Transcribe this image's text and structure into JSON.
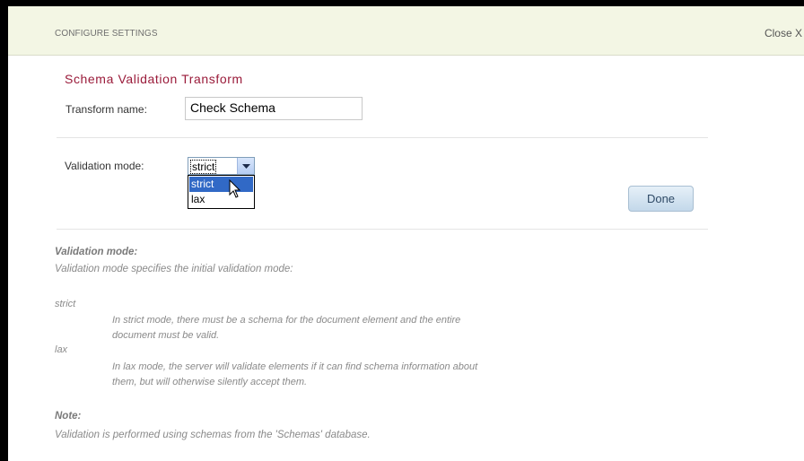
{
  "dialog": {
    "header_title": "CONFIGURE SETTINGS",
    "close_label": "Close X"
  },
  "form": {
    "section_title": "Schema Validation Transform",
    "transform_name_label": "Transform name:",
    "transform_name_value": "Check Schema",
    "validation_mode_label": "Validation mode:",
    "validation_mode_selected": "strict",
    "validation_mode_options": [
      "strict",
      "lax"
    ],
    "done_label": "Done"
  },
  "help": {
    "heading": "Validation mode:",
    "intro": "Validation mode specifies the initial validation mode:",
    "terms": [
      {
        "term": "strict",
        "line1": "In strict mode, there must be a schema for the document element and the entire",
        "line2": "document must be valid."
      },
      {
        "term": "lax",
        "line1": "In lax mode, the server will validate elements if it can find schema information about",
        "line2": "them, but will otherwise silently accept them."
      }
    ],
    "note_heading": "Note:",
    "note_text": "Validation is performed using schemas from the 'Schemas' database."
  },
  "icons": {
    "dropdown_arrow": "chevron-down-icon",
    "cursor": "mouse-pointer-icon"
  },
  "colors": {
    "header_bg": "#f3f6e4",
    "section_title": "#9a1b3a",
    "selected_option": "#3169c6"
  }
}
